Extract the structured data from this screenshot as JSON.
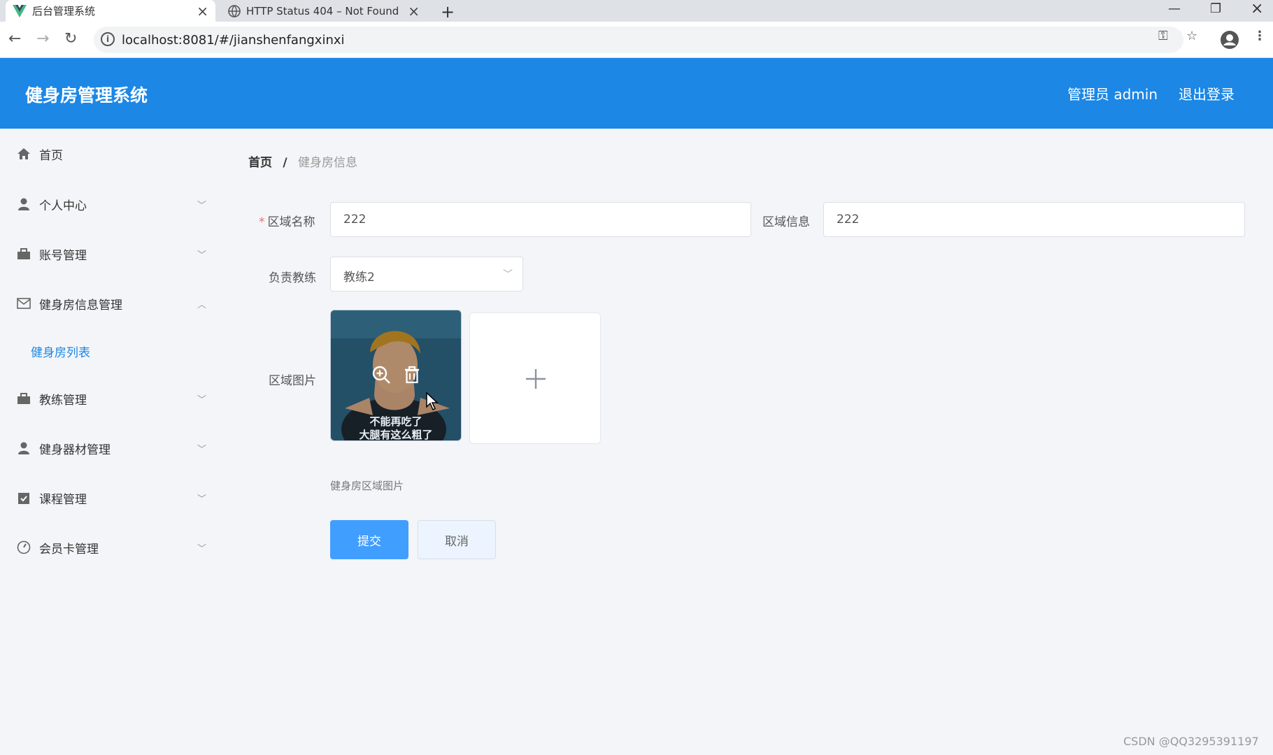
{
  "browser": {
    "tabs": [
      {
        "title": "后台管理系统",
        "active": true
      },
      {
        "title": "HTTP Status 404 – Not Found",
        "active": false
      }
    ],
    "url": "localhost:8081/#/jianshenfangxinxi"
  },
  "header": {
    "title": "健身房管理系统",
    "admin_label": "管理员 admin",
    "logout_label": "退出登录"
  },
  "sidebar": {
    "items": [
      {
        "label": "首页",
        "icon": "home-icon",
        "arrow": ""
      },
      {
        "label": "个人中心",
        "icon": "user-icon",
        "arrow": "﹀"
      },
      {
        "label": "账号管理",
        "icon": "briefcase-icon",
        "arrow": "﹀"
      },
      {
        "label": "健身房信息管理",
        "icon": "mail-icon",
        "arrow": "︿"
      },
      {
        "label": "教练管理",
        "icon": "briefcase-icon",
        "arrow": "﹀"
      },
      {
        "label": "健身器材管理",
        "icon": "user-icon",
        "arrow": "﹀"
      },
      {
        "label": "课程管理",
        "icon": "clipboard-icon",
        "arrow": "﹀"
      },
      {
        "label": "会员卡管理",
        "icon": "gauge-icon",
        "arrow": "﹀"
      }
    ],
    "submenu": {
      "label": "健身房列表"
    }
  },
  "breadcrumb": {
    "home": "首页",
    "separator": "/",
    "current": "健身房信息"
  },
  "form": {
    "area_name_label": "区域名称",
    "area_name_required": "*",
    "area_name_value": "222",
    "area_info_label": "区域信息",
    "area_info_value": "222",
    "coach_label": "负责教练",
    "coach_value": "教练2",
    "image_label": "区域图片",
    "image_caption_line1": "不能再吃了",
    "image_caption_line2": "大腿有这么粗了",
    "image_hint": "健身房区域图片",
    "submit_label": "提交",
    "cancel_label": "取消"
  },
  "watermark": "CSDN @QQ3295391197",
  "colors": {
    "brand": "#1c87e5",
    "primary_button": "#409eff",
    "background": "#f3f5f8"
  }
}
